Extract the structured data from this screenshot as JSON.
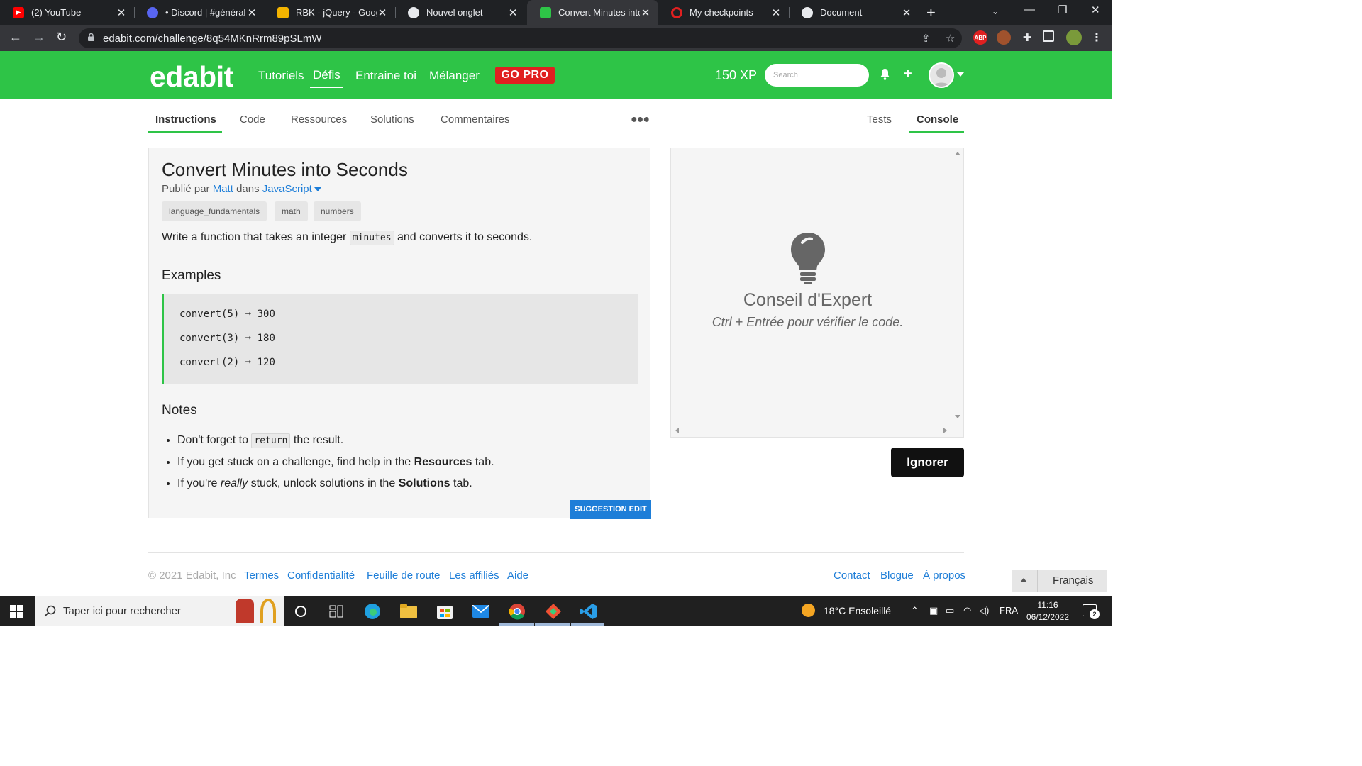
{
  "browser": {
    "tabs": [
      {
        "title": "(2) YouTube",
        "icon": "youtube-icon",
        "color": "#ff0000"
      },
      {
        "title": "• Discord | #général |",
        "icon": "discord-icon",
        "color": "#5865f2"
      },
      {
        "title": "RBK - jQuery - Google",
        "icon": "google-slides-icon",
        "color": "#f4b400"
      },
      {
        "title": "Nouvel onglet",
        "icon": "chrome-icon",
        "color": "#e8eaed"
      },
      {
        "title": "Convert Minutes into",
        "icon": "edabit-icon",
        "color": "#2ec447"
      },
      {
        "title": "My checkpoints",
        "icon": "opera-icon",
        "color": "#e02020"
      },
      {
        "title": "Document",
        "icon": "globe-icon",
        "color": "#e8eaed"
      }
    ],
    "url": "edabit.com/challenge/8q54MKnRrm89pSLmW"
  },
  "header": {
    "logo": "edabit",
    "nav": [
      "Tutoriels",
      "Défis",
      "Entraine toi",
      "Mélanger"
    ],
    "gopro": "GO PRO",
    "xp": "150 XP",
    "search_placeholder": "Search",
    "brand_color": "#2ec447"
  },
  "subtabs": {
    "left": [
      "Instructions",
      "Code",
      "Ressources",
      "Solutions",
      "Commentaires"
    ],
    "right": [
      "Tests",
      "Console"
    ]
  },
  "challenge": {
    "title": "Convert Minutes into Seconds",
    "published_by": "Publié par",
    "author": "Matt",
    "in": "dans",
    "language": "JavaScript",
    "tags": [
      "language_fundamentals",
      "math",
      "numbers"
    ],
    "desc_before": "Write a function that takes an integer",
    "desc_code": "minutes",
    "desc_after": "and converts it to seconds.",
    "examples_heading": "Examples",
    "examples": [
      {
        "call": "convert(5)",
        "result": "300"
      },
      {
        "call": "convert(3)",
        "result": "180"
      },
      {
        "call": "convert(2)",
        "result": "120"
      }
    ],
    "notes_heading": "Notes",
    "note1_before": "Don't forget to",
    "note1_code": "return",
    "note1_after": "the result.",
    "note2_before": "If you get stuck on a challenge, find help in the",
    "note2_bold": "Resources",
    "note2_after": "tab.",
    "note3_before": "If you're",
    "note3_italic": "really",
    "note3_mid": "stuck, unlock solutions in the",
    "note3_bold": "Solutions",
    "note3_after": "tab.",
    "suggestion": "SUGGESTION EDIT"
  },
  "console": {
    "tip_title": "Conseil d'Expert",
    "tip_sub": "Ctrl + Entrée pour vérifier le code.",
    "ignore": "Ignorer"
  },
  "footer": {
    "copyright": "© 2021 Edabit, Inc",
    "links_left": [
      "Termes",
      "Confidentialité",
      "Feuille de route",
      "Les affiliés",
      "Aide"
    ],
    "links_right": [
      "Contact",
      "Blogue",
      "À propos"
    ],
    "language": "Français"
  },
  "taskbar": {
    "search_placeholder": "Taper ici pour rechercher",
    "weather": "18°C  Ensoleillé",
    "lang": "FRA",
    "time": "11:16",
    "date": "06/12/2022",
    "notifications": "2"
  }
}
